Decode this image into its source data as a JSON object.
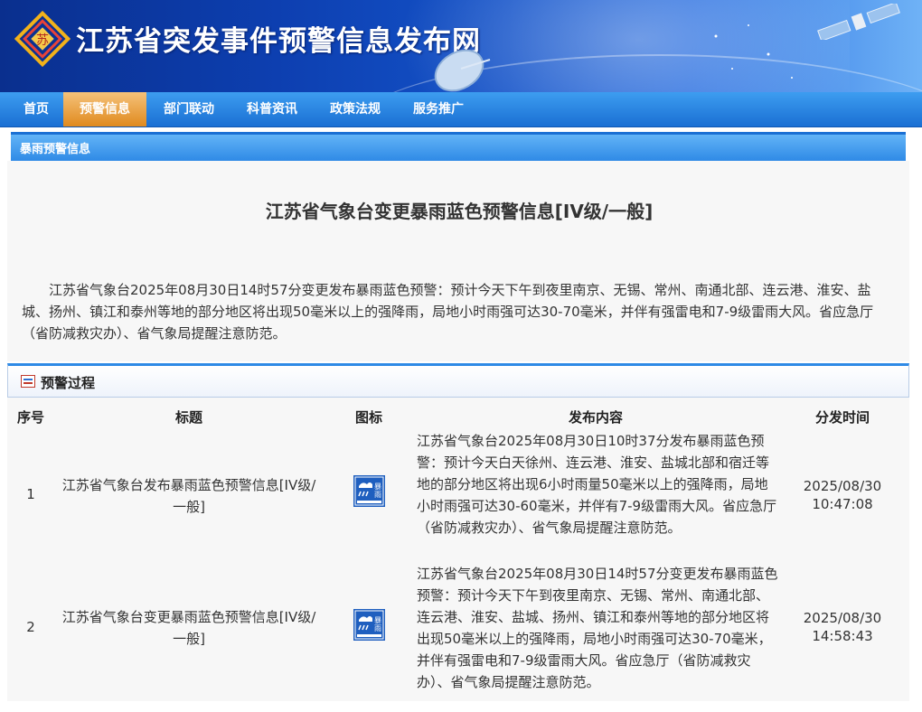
{
  "site": {
    "title": "江苏省突发事件预警信息发布网",
    "logo_icon": "jiangsu-emergency-logo-icon"
  },
  "nav": {
    "items": [
      "首页",
      "预警信息",
      "部门联动",
      "科普资讯",
      "政策法规",
      "服务推广"
    ],
    "active_index": 1
  },
  "section": {
    "title": "暴雨预警信息"
  },
  "article": {
    "title": "江苏省气象台变更暴雨蓝色预警信息[IV级/一般]",
    "body": "江苏省气象台2025年08月30日14时57分变更发布暴雨蓝色预警：预计今天下午到夜里南京、无锡、常州、南通北部、连云港、淮安、盐城、扬州、镇江和泰州等地的部分地区将出现50毫米以上的强降雨，局地小时雨强可达30-70毫米，并伴有强雷电和7-9级雷雨大风。省应急厅（省防减救灾办）、省气象局提醒注意防范。"
  },
  "process": {
    "title": "预警过程",
    "headers": [
      "序号",
      "标题",
      "图标",
      "发布内容",
      "分发时间"
    ],
    "rows": [
      {
        "index": "1",
        "title": "江苏省气象台发布暴雨蓝色预警信息[IV级/一般]",
        "icon": "rainstorm-blue-warning-icon",
        "content": "江苏省气象台2025年08月30日10时37分发布暴雨蓝色预警：预计今天白天徐州、连云港、淮安、盐城北部和宿迁等地的部分地区将出现6小时雨量50毫米以上的强降雨，局地小时雨强可达30-60毫米，并伴有7-9级雷雨大风。省应急厅（省防减救灾办）、省气象局提醒注意防范。",
        "time": "2025/08/30 10:47:08"
      },
      {
        "index": "2",
        "title": "江苏省气象台变更暴雨蓝色预警信息[IV级/一般]",
        "icon": "rainstorm-blue-warning-icon",
        "content": "江苏省气象台2025年08月30日14时57分变更发布暴雨蓝色预警：预计今天下午到夜里南京、无锡、常州、南通北部、连云港、淮安、盐城、扬州、镇江和泰州等地的部分地区将出现50毫米以上的强降雨，局地小时雨强可达30-70毫米，并伴有强雷电和7-9级雷雨大风。省应急厅（省防减救灾办）、省气象局提醒注意防范。",
        "time": "2025/08/30 14:58:43"
      }
    ]
  },
  "colors": {
    "header_dark": "#0a2f8e",
    "nav_blue": "#1a6fd3",
    "nav_active": "#e08a1e",
    "warning_blue": "#1f5fbf"
  }
}
